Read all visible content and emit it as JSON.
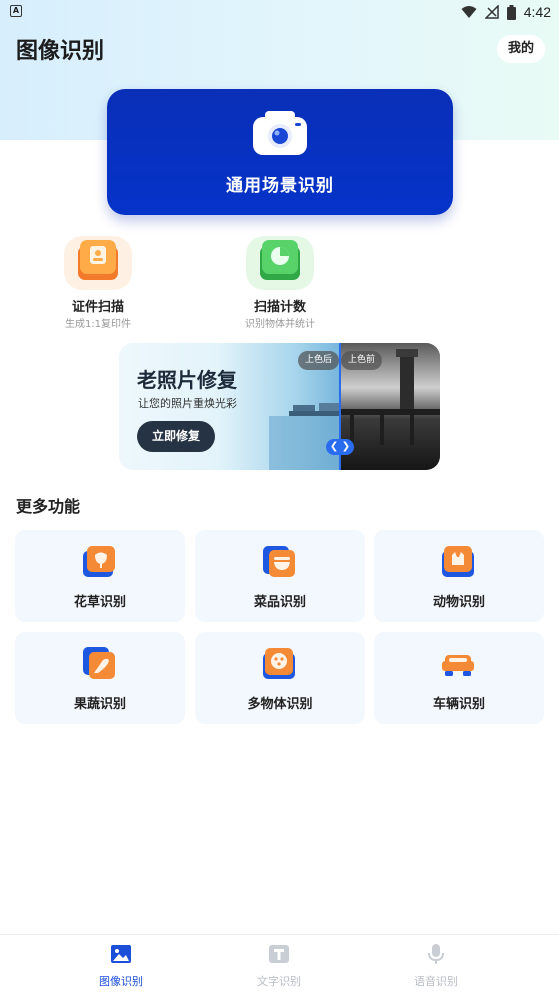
{
  "status_bar": {
    "time": "4:42",
    "left_icon": "A"
  },
  "header": {
    "title": "图像识别",
    "mine_label": "我的"
  },
  "hero": {
    "label": "通用场景识别",
    "icon": "camera-icon",
    "color": "#0533c9"
  },
  "tools": [
    {
      "title": "证件扫描",
      "subtitle": "生成1:1复印件",
      "icon": "id-card-icon"
    },
    {
      "title": "扫描计数",
      "subtitle": "识别物体并统计",
      "icon": "chart-icon"
    }
  ],
  "banner": {
    "title": "老照片修复",
    "subtitle": "让您的照片重焕光彩",
    "button": "立即修复",
    "tag_after": "上色后",
    "tag_before": "上色前",
    "handle": "❮ ❯"
  },
  "more": {
    "title": "更多功能",
    "items": [
      {
        "label": "花草识别",
        "icon": "flower-icon"
      },
      {
        "label": "菜品识别",
        "icon": "dish-icon"
      },
      {
        "label": "动物识别",
        "icon": "animal-icon"
      },
      {
        "label": "果蔬识别",
        "icon": "fruit-icon"
      },
      {
        "label": "多物体识别",
        "icon": "multi-object-icon"
      },
      {
        "label": "车辆识别",
        "icon": "car-icon"
      }
    ]
  },
  "nav": [
    {
      "label": "图像识别",
      "active": true
    },
    {
      "label": "文字识别",
      "active": false
    },
    {
      "label": "语音识别",
      "active": false
    }
  ],
  "colors": {
    "accent": "#1c4fd8",
    "orange": "#f0813a",
    "green": "#45c35c"
  }
}
